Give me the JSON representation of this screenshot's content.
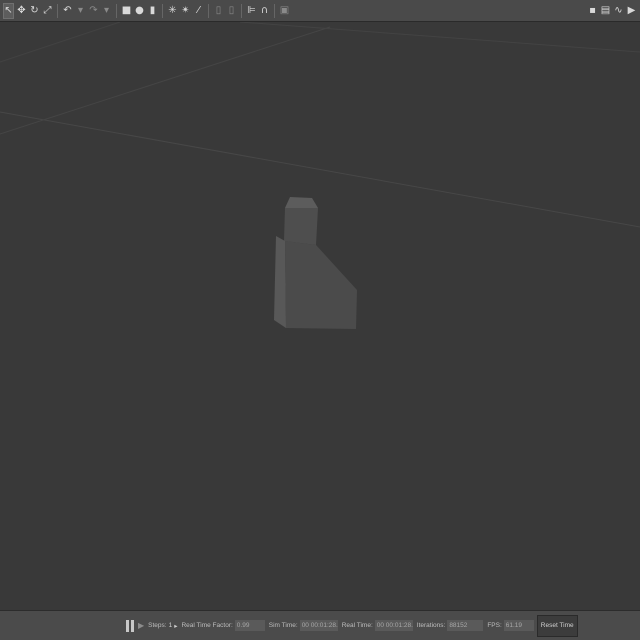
{
  "toolbar": {
    "left_icons": [
      {
        "name": "select-mode-icon",
        "glyph": "↖",
        "active": true
      },
      {
        "name": "translate-mode-icon",
        "glyph": "✥"
      },
      {
        "name": "rotate-mode-icon",
        "glyph": "↻"
      },
      {
        "name": "scale-mode-icon",
        "glyph": "⤢"
      },
      {
        "sep": true
      },
      {
        "name": "undo-icon",
        "glyph": "↶"
      },
      {
        "name": "undo-history-icon",
        "glyph": "▾",
        "dim": true
      },
      {
        "name": "redo-icon",
        "glyph": "↷",
        "dim": true
      },
      {
        "name": "redo-history-icon",
        "glyph": "▾",
        "dim": true
      },
      {
        "sep": true
      },
      {
        "name": "box-shape-icon",
        "glyph": "■"
      },
      {
        "name": "sphere-shape-icon",
        "glyph": "●"
      },
      {
        "name": "cylinder-shape-icon",
        "glyph": "▮"
      },
      {
        "sep": true
      },
      {
        "name": "point-light-icon",
        "glyph": "✳"
      },
      {
        "name": "spot-light-icon",
        "glyph": "✴"
      },
      {
        "name": "directional-light-icon",
        "glyph": "⁄"
      },
      {
        "sep": true
      },
      {
        "name": "copy-icon",
        "glyph": "▯",
        "dim": true
      },
      {
        "name": "paste-icon",
        "glyph": "▯",
        "dim": true
      },
      {
        "sep": true
      },
      {
        "name": "align-icon",
        "glyph": "⊫"
      },
      {
        "name": "snap-icon",
        "glyph": "∩"
      },
      {
        "sep": true
      },
      {
        "name": "change-view-icon",
        "glyph": "▣",
        "dim": true
      }
    ],
    "right_icons": [
      {
        "name": "screenshot-icon",
        "glyph": "▪"
      },
      {
        "name": "log-icon",
        "glyph": "▤"
      },
      {
        "name": "plot-icon",
        "glyph": "∿"
      },
      {
        "name": "video-record-icon",
        "glyph": "▶"
      }
    ]
  },
  "statusbar": {
    "steps_label": "Steps:",
    "steps_value": "1",
    "rtf_label": "Real Time Factor:",
    "rtf_value": "0.99",
    "sim_time_label": "Sim Time:",
    "sim_time_value": "00 00:01:28.152",
    "real_time_label": "Real Time:",
    "real_time_value": "00 00:01:28.757",
    "iterations_label": "Iterations:",
    "iterations_value": "88152",
    "fps_label": "FPS:",
    "fps_value": "61.19",
    "reset_label": "Reset Time"
  },
  "colors": {
    "background": "#393939",
    "toolbar": "#4a4a4a",
    "model_front": "#4f4f4f",
    "model_side": "#5a5a5a",
    "grid": "#474747"
  }
}
